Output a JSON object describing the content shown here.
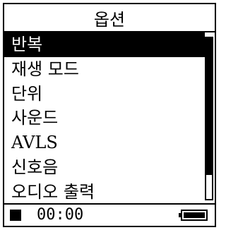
{
  "header": {
    "title": "옵션"
  },
  "menu": {
    "items": [
      {
        "label": "반복",
        "selected": true
      },
      {
        "label": "재생 모드",
        "selected": false
      },
      {
        "label": "단위",
        "selected": false
      },
      {
        "label": "사운드",
        "selected": false
      },
      {
        "label": "AVLS",
        "selected": false
      },
      {
        "label": "신호음",
        "selected": false
      },
      {
        "label": "오디오 출력",
        "selected": false
      }
    ]
  },
  "scrollbar": {
    "visible_fraction": 0.85,
    "position_fraction": 0.0
  },
  "status": {
    "playback_state_icon": "stop-icon",
    "time": "00:00",
    "battery_icon": "battery-icon",
    "battery_level": 1.0
  }
}
